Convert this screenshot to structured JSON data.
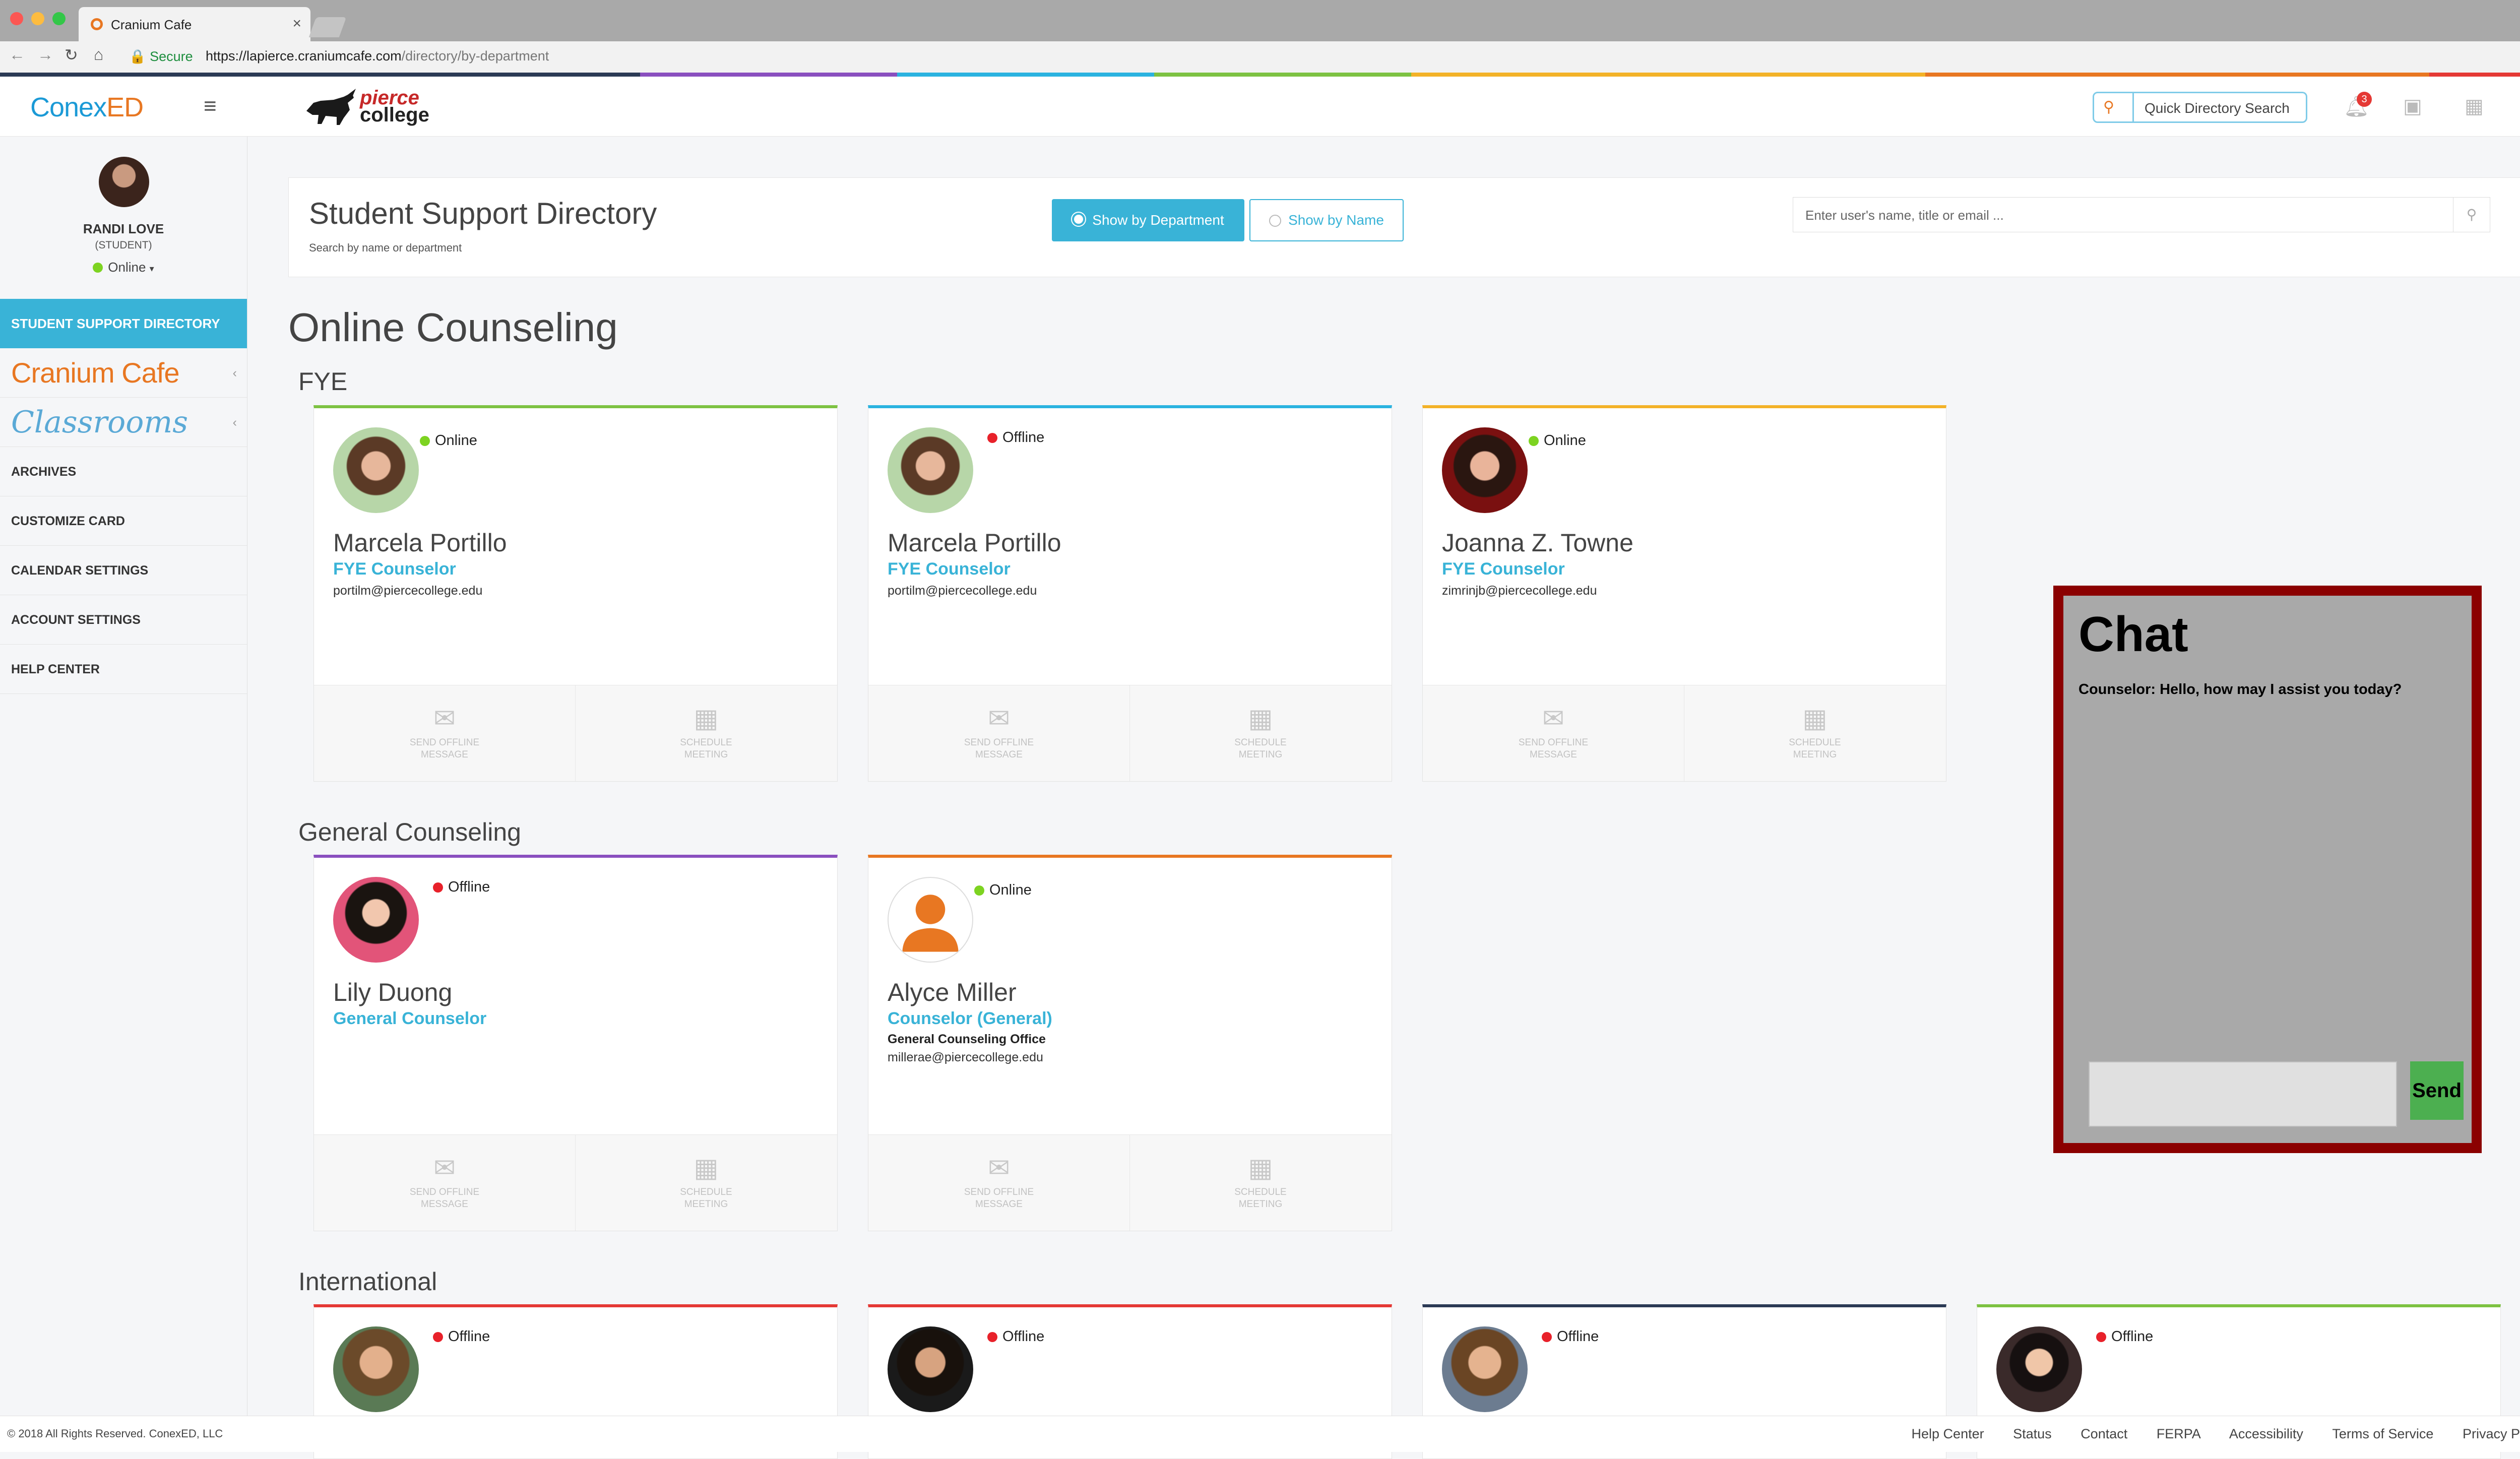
{
  "browser": {
    "tab_title": "Cranium Cafe",
    "secure_label": "Secure",
    "url_host": "https://lapierce.craniumcafe.com",
    "url_path": "/directory/by-department"
  },
  "header": {
    "brand_part1": "Conex",
    "brand_part2": "ED",
    "college_logo_line1": "pierce",
    "college_logo_line2": "college",
    "quick_search_label": "Quick Directory Search",
    "notification_count": "3",
    "stripe_colors": [
      "#2b3a55",
      "#8a4fbf",
      "#2bb3e0",
      "#7dc242",
      "#f3b228",
      "#e87722",
      "#e53935"
    ]
  },
  "sidebar": {
    "user_name": "RANDI LOVE",
    "user_role": "(STUDENT)",
    "user_status": "Online",
    "active_item": "STUDENT SUPPORT DIRECTORY",
    "cranium_logo_text": "Cranium Cafe",
    "classrooms_logo_text": "Classrooms",
    "items": [
      "ARCHIVES",
      "CUSTOMIZE CARD",
      "CALENDAR SETTINGS",
      "ACCOUNT SETTINGS",
      "HELP CENTER"
    ]
  },
  "directory": {
    "title": "Student Support Directory",
    "subtitle": "Search by name or department",
    "btn_department": "Show by Department",
    "btn_name": "Show by Name",
    "search_placeholder": "Enter user's name, title or email ..."
  },
  "section_title": "Online Counseling",
  "groups": [
    {
      "title": "FYE",
      "cards": [
        {
          "status": "Online",
          "name": "Marcela Portillo",
          "role": "FYE Counselor",
          "email": "portilm@piercecollege.edu",
          "accent": "#7dc242"
        },
        {
          "status": "Offline",
          "name": "Marcela Portillo",
          "role": "FYE Counselor",
          "email": "portilm@piercecollege.edu",
          "accent": "#2bb3e0"
        },
        {
          "status": "Online",
          "name": "Joanna Z. Towne",
          "role": "FYE Counselor",
          "email": "zimrinjb@piercecollege.edu",
          "accent": "#f3b228"
        }
      ]
    },
    {
      "title": "General Counseling",
      "cards": [
        {
          "status": "Offline",
          "name": "Lily Duong",
          "role": "General Counselor",
          "accent": "#8a4fbf"
        },
        {
          "status": "Online",
          "name": "Alyce Miller",
          "role": "Counselor (General)",
          "office": "General Counseling Office",
          "email": "millerae@piercecollege.edu",
          "accent": "#e87722"
        }
      ]
    },
    {
      "title": "International",
      "cards": [
        {
          "status": "Offline",
          "accent": "#e53935"
        },
        {
          "status": "Offline",
          "accent": "#e53935"
        },
        {
          "status": "Offline",
          "accent": "#2b3a55"
        },
        {
          "status": "Offline",
          "accent": "#7dc242"
        }
      ]
    }
  ],
  "card_actions": {
    "message_line1": "SEND OFFLINE",
    "message_line2": "MESSAGE",
    "meeting_line1": "SCHEDULE",
    "meeting_line2": "MEETING"
  },
  "chat": {
    "title": "Chat",
    "message": "Counselor: Hello, how may I assist you today?",
    "send_label": "Send"
  },
  "footer": {
    "copyright": "© 2018 All Rights Reserved. ConexED, LLC",
    "links": [
      "Help Center",
      "Status",
      "Contact",
      "FERPA",
      "Accessibility",
      "Terms of Service",
      "Privacy Policy"
    ]
  }
}
